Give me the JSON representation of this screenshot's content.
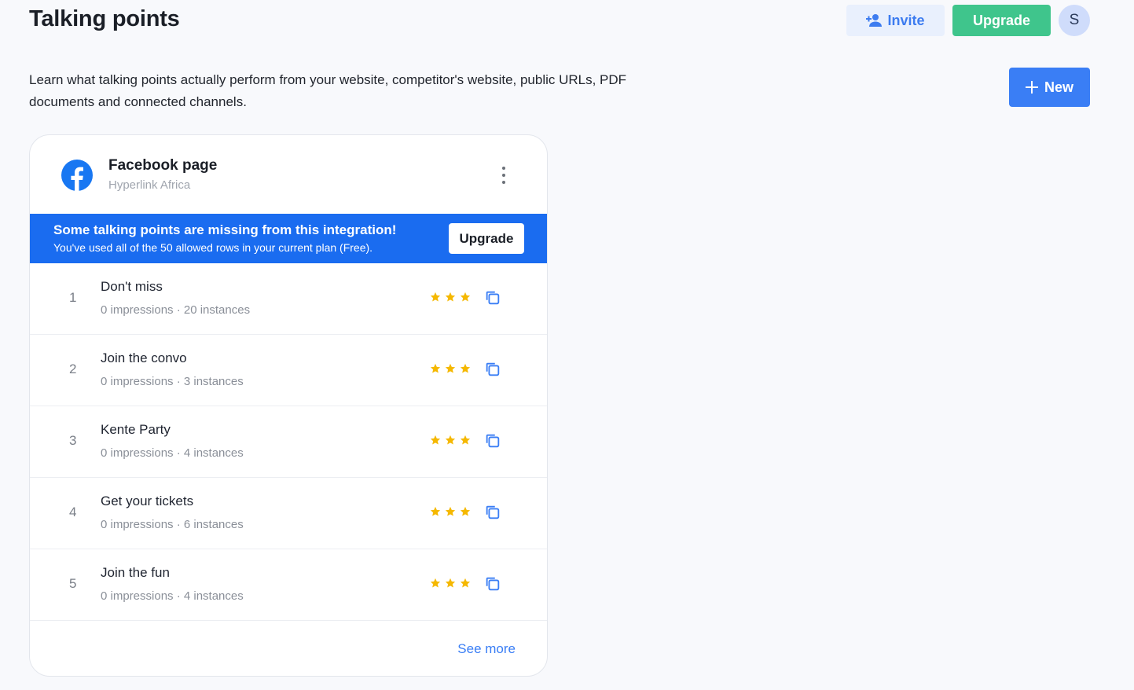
{
  "header": {
    "title": "Talking points",
    "invite_label": "Invite",
    "upgrade_label": "Upgrade",
    "avatar_initial": "S"
  },
  "description": "Learn what talking points actually perform from your website, competitor's website, public URLs, PDF documents and connected channels.",
  "new_button_label": "New",
  "card": {
    "title": "Facebook page",
    "subtitle": "Hyperlink Africa",
    "banner": {
      "title": "Some talking points are missing from this integration!",
      "text": "You've used all of the 50 allowed rows in your current plan (Free).",
      "button_label": "Upgrade"
    },
    "rows": [
      {
        "num": "1",
        "title": "Don't miss",
        "meta": "0 impressions · 20 instances",
        "stars": 3
      },
      {
        "num": "2",
        "title": "Join the convo",
        "meta": "0 impressions · 3 instances",
        "stars": 3
      },
      {
        "num": "3",
        "title": "Kente Party",
        "meta": "0 impressions · 4 instances",
        "stars": 3
      },
      {
        "num": "4",
        "title": "Get your tickets",
        "meta": "0 impressions · 6 instances",
        "stars": 3
      },
      {
        "num": "5",
        "title": "Join the fun",
        "meta": "0 impressions · 4 instances",
        "stars": 3
      }
    ],
    "see_more_label": "See more"
  },
  "colors": {
    "accent": "#3a7ef5",
    "banner": "#1a6cf0",
    "upgrade_green": "#3fc58c",
    "star": "#f5b800"
  },
  "icons": {
    "invite": "add-user-icon",
    "new": "plus-icon",
    "channel": "facebook-icon",
    "menu": "kebab-menu-icon",
    "copy": "copy-icon",
    "rating": "star-icon"
  }
}
